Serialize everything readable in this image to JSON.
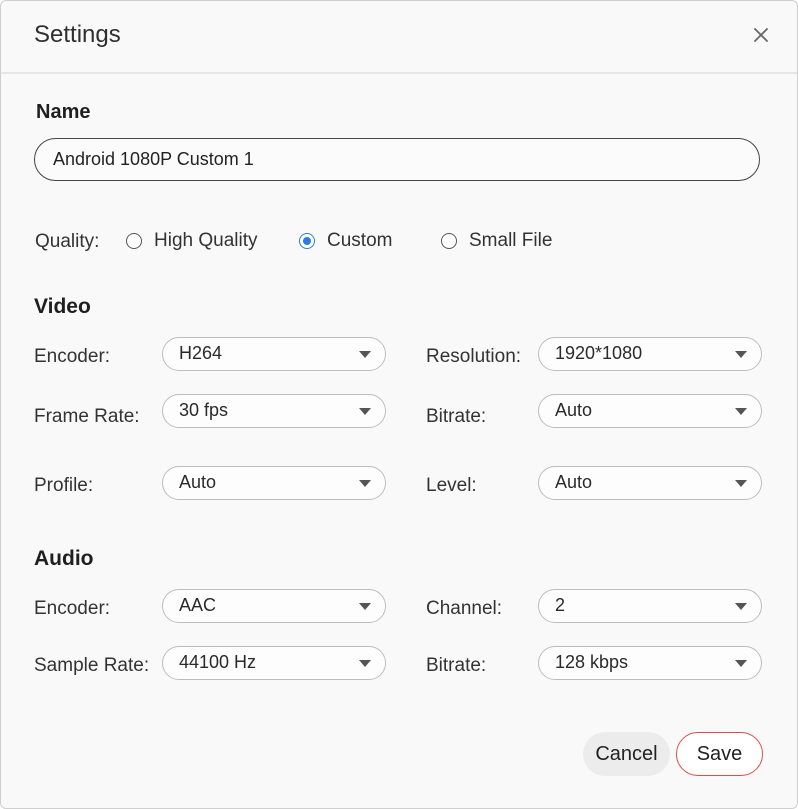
{
  "dialog": {
    "title": "Settings",
    "close_icon": "close-icon"
  },
  "name": {
    "label": "Name",
    "value": "Android 1080P Custom 1"
  },
  "quality": {
    "label": "Quality:",
    "options": [
      {
        "label": "High Quality",
        "checked": false
      },
      {
        "label": "Custom",
        "checked": true
      },
      {
        "label": "Small File",
        "checked": false
      }
    ],
    "accent_color": "#2d7be0"
  },
  "video": {
    "title": "Video",
    "encoder": {
      "label": "Encoder:",
      "value": "H264"
    },
    "resolution": {
      "label": "Resolution:",
      "value": "1920*1080"
    },
    "frame_rate": {
      "label": "Frame Rate:",
      "value": "30 fps"
    },
    "bitrate": {
      "label": "Bitrate:",
      "value": "Auto"
    },
    "profile": {
      "label": "Profile:",
      "value": "Auto"
    },
    "level": {
      "label": "Level:",
      "value": "Auto"
    }
  },
  "audio": {
    "title": "Audio",
    "encoder": {
      "label": "Encoder:",
      "value": "AAC"
    },
    "channel": {
      "label": "Channel:",
      "value": "2"
    },
    "sample_rate": {
      "label": "Sample Rate:",
      "value": "44100 Hz"
    },
    "bitrate": {
      "label": "Bitrate:",
      "value": "128 kbps"
    }
  },
  "buttons": {
    "cancel": "Cancel",
    "save": "Save",
    "save_border_color": "#e24b4b"
  },
  "icons": {
    "dropdown": "chevron-down-icon"
  }
}
